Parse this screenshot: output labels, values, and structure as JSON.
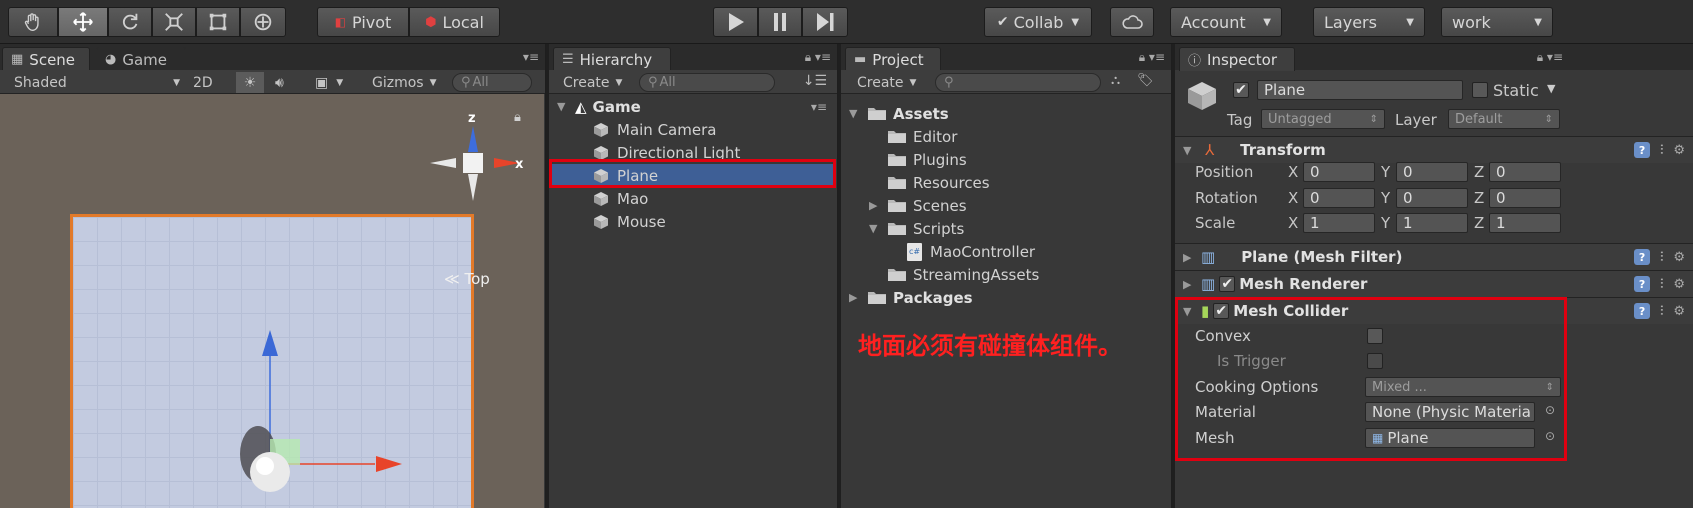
{
  "toolbar": {
    "tools": [
      "hand-tool",
      "move-tool",
      "rotate-tool",
      "scale-tool",
      "rect-tool",
      "transform-tool"
    ],
    "pivot_label": "Pivot",
    "local_label": "Local",
    "collab_label": "Collab",
    "account_label": "Account",
    "layers_label": "Layers",
    "layout_label": "work"
  },
  "scene_panel": {
    "tab_scene": "Scene",
    "tab_game": "Game",
    "shading_mode": "Shaded",
    "mode_2d": "2D",
    "gizmos_label": "Gizmos",
    "search_placeholder": "All",
    "gizmo_labels": {
      "z": "z",
      "x": "x",
      "view": "Top"
    }
  },
  "hierarchy": {
    "tab": "Hierarchy",
    "create_label": "Create",
    "search_placeholder": "All",
    "scene_name": "Game",
    "items": [
      {
        "label": "Main Camera"
      },
      {
        "label": "Directional Light"
      },
      {
        "label": "Plane",
        "selected": true
      },
      {
        "label": "Mao"
      },
      {
        "label": "Mouse"
      }
    ]
  },
  "project": {
    "tab": "Project",
    "create_label": "Create",
    "tree": {
      "assets": "Assets",
      "editor": "Editor",
      "plugins": "Plugins",
      "resources": "Resources",
      "scenes": "Scenes",
      "scripts": "Scripts",
      "mao_controller": "MaoController",
      "streaming_assets": "StreamingAssets",
      "packages": "Packages"
    },
    "script_badge": "c#"
  },
  "inspector": {
    "tab": "Inspector",
    "object_name": "Plane",
    "static_label": "Static",
    "tag_label": "Tag",
    "tag_value": "Untagged",
    "layer_label": "Layer",
    "layer_value": "Default",
    "transform": {
      "title": "Transform",
      "position_label": "Position",
      "rotation_label": "Rotation",
      "scale_label": "Scale",
      "axis_x": "X",
      "axis_y": "Y",
      "axis_z": "Z",
      "position": [
        "0",
        "0",
        "0"
      ],
      "rotation": [
        "0",
        "0",
        "0"
      ],
      "scale": [
        "1",
        "1",
        "1"
      ]
    },
    "mesh_filter_title": "Plane (Mesh Filter)",
    "mesh_renderer_title": "Mesh Renderer",
    "mesh_collider": {
      "title": "Mesh Collider",
      "convex_label": "Convex",
      "is_trigger_label": "Is Trigger",
      "cooking_label": "Cooking Options",
      "cooking_value": "Mixed ...",
      "material_label": "Material",
      "material_value": "None (Physic Materia",
      "mesh_label": "Mesh",
      "mesh_value": "Plane"
    }
  },
  "annotation_text": "地面必须有碰撞体组件。",
  "colors": {
    "selection": "#3e5f96",
    "highlight_box": "#e00010",
    "annotation": "#ff2020",
    "ground_outline": "#e27a2a"
  }
}
